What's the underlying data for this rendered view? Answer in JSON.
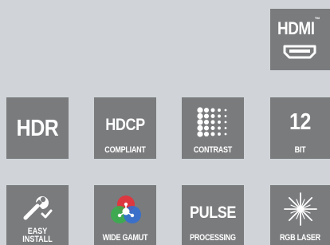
{
  "colors": {
    "background": "#d0d4d8",
    "tile": "#7a7b7d",
    "text": "#ffffff"
  },
  "tiles": {
    "hdmi": {
      "title": "HDMI",
      "trademark": "™",
      "icon": "hdmi-port-icon"
    },
    "hdr": {
      "title": "HDR"
    },
    "hdcp": {
      "title": "HDCP",
      "subtitle": "COMPLIANT"
    },
    "contrast": {
      "subtitle": "CONTRAST",
      "icon": "dot-matrix-contrast-icon"
    },
    "bit": {
      "title": "12",
      "subtitle": "BIT"
    },
    "easy_install": {
      "line1": "EASY",
      "line2": "INSTALL",
      "icon": "wrench-check-icon"
    },
    "wide_gamut": {
      "subtitle": "WIDE GAMUT",
      "icon": "rgb-circles-icon"
    },
    "pulse": {
      "title": "PULSE",
      "subtitle": "PROCESSING"
    },
    "rgb_laser": {
      "subtitle": "RGB LASER",
      "icon": "laser-burst-icon"
    }
  }
}
